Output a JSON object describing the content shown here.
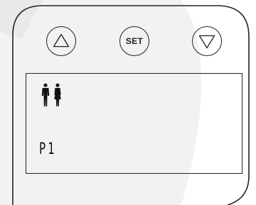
{
  "controls": {
    "up_button": {
      "icon": "triangle-up-icon"
    },
    "set_button": {
      "label": "SET"
    },
    "down_button": {
      "icon": "triangle-down-icon"
    }
  },
  "display": {
    "user_icon": "male-female-users-icon",
    "profile_code": "P1"
  },
  "colors": {
    "outline": "#222222",
    "background": "#ffffff",
    "shadow_band": "#f2f2f2"
  }
}
